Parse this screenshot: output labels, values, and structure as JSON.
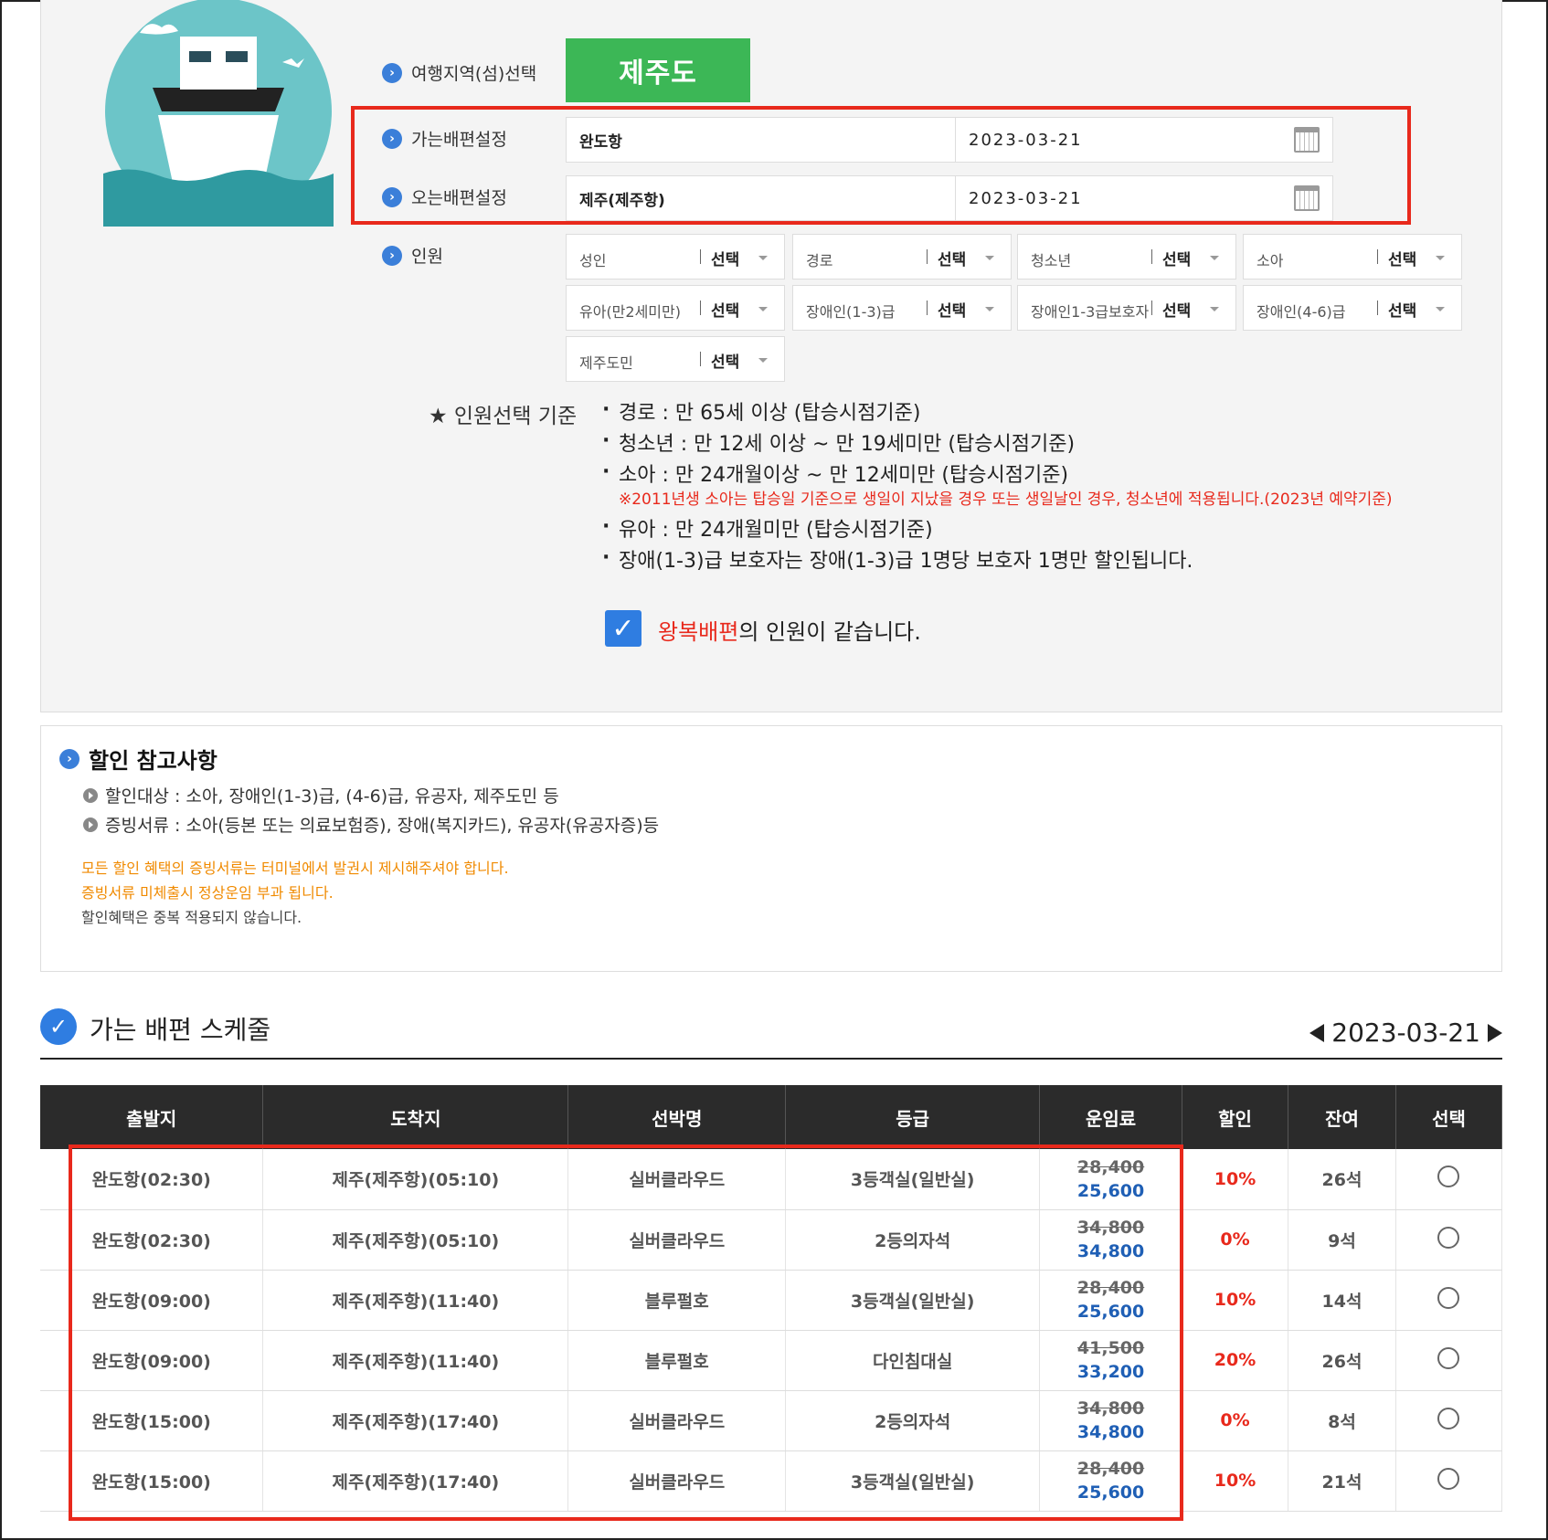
{
  "region": {
    "label": "여행지역(섬)선택",
    "value": "제주도"
  },
  "outbound": {
    "label": "가는배편설정",
    "port": "완도항",
    "date": "2023-03-21"
  },
  "return": {
    "label": "오는배편설정",
    "port": "제주(제주항)",
    "date": "2023-03-21"
  },
  "passengers": {
    "label": "인원",
    "select_label": "선택",
    "types": [
      "성인",
      "경로",
      "청소년",
      "소아",
      "유아(만2세미만)",
      "장애인(1-3)급",
      "장애인1-3급보호자",
      "장애인(4-6)급",
      "제주도민"
    ]
  },
  "criteria": {
    "title": "★ 인원선택 기준",
    "items": [
      "경로 : 만 65세 이상 (탑승시점기준)",
      "청소년 : 만 12세 이상 ~ 만 19세미만 (탑승시점기준)",
      "소아 : 만 24개월이상 ~ 만 12세미만 (탑승시점기준)",
      "유아 : 만 24개월미만 (탑승시점기준)",
      "장애(1-3)급 보호자는 장애(1-3)급 1명당 보호자 1명만 할인됩니다."
    ],
    "note": "※2011년생 소아는 탑승일 기준으로 생일이 지났을 경우 또는 생일날인 경우, 청소년에 적용됩니다.(2023년 예약기준)"
  },
  "same_passengers": {
    "red": "왕복배편",
    "rest": "의 인원이 같습니다.",
    "checked": true
  },
  "discount": {
    "title": "할인 참고사항",
    "bullets": [
      "할인대상 : 소아, 장애인(1-3)급, (4-6)급, 유공자, 제주도민 등",
      "증빙서류 : 소아(등본 또는 의료보험증), 장애(복지카드), 유공자(유공자증)등"
    ],
    "notes": [
      "모든 할인 혜택의 증빙서류는 터미널에서 발권시 제시해주셔야 합니다.",
      "증빙서류 미체출시 정상운임 부과 됩니다.",
      "할인혜택은 중복 적용되지 않습니다."
    ],
    "note_colors": [
      "#f08a00",
      "#f08a00",
      "#444444"
    ]
  },
  "schedule": {
    "title": "가는 배편 스케줄",
    "date": "2023-03-21",
    "headers": [
      "출발지",
      "도착지",
      "선박명",
      "등급",
      "운임료",
      "할인",
      "잔여",
      "선택"
    ],
    "rows": [
      {
        "dep": "완도항(02:30)",
        "arr": "제주(제주항)(05:10)",
        "ship": "실버클라우드",
        "grade": "3등객실(일반실)",
        "fare_old": "28,400",
        "fare_new": "25,600",
        "disc": "10%",
        "remain": "26석"
      },
      {
        "dep": "완도항(02:30)",
        "arr": "제주(제주항)(05:10)",
        "ship": "실버클라우드",
        "grade": "2등의자석",
        "fare_old": "34,800",
        "fare_new": "34,800",
        "disc": "0%",
        "remain": "9석"
      },
      {
        "dep": "완도항(09:00)",
        "arr": "제주(제주항)(11:40)",
        "ship": "블루펄호",
        "grade": "3등객실(일반실)",
        "fare_old": "28,400",
        "fare_new": "25,600",
        "disc": "10%",
        "remain": "14석"
      },
      {
        "dep": "완도항(09:00)",
        "arr": "제주(제주항)(11:40)",
        "ship": "블루펄호",
        "grade": "다인침대실",
        "fare_old": "41,500",
        "fare_new": "33,200",
        "disc": "20%",
        "remain": "26석"
      },
      {
        "dep": "완도항(15:00)",
        "arr": "제주(제주항)(17:40)",
        "ship": "실버클라우드",
        "grade": "2등의자석",
        "fare_old": "34,800",
        "fare_new": "34,800",
        "disc": "0%",
        "remain": "8석"
      },
      {
        "dep": "완도항(15:00)",
        "arr": "제주(제주항)(17:40)",
        "ship": "실버클라우드",
        "grade": "3등객실(일반실)",
        "fare_old": "28,400",
        "fare_new": "25,600",
        "disc": "10%",
        "remain": "21석"
      }
    ]
  },
  "colors": {
    "accent": "#2f7de1",
    "region_green": "#3cb756",
    "highlight_red": "#e8291c",
    "fare_blue": "#1f5fb5"
  }
}
